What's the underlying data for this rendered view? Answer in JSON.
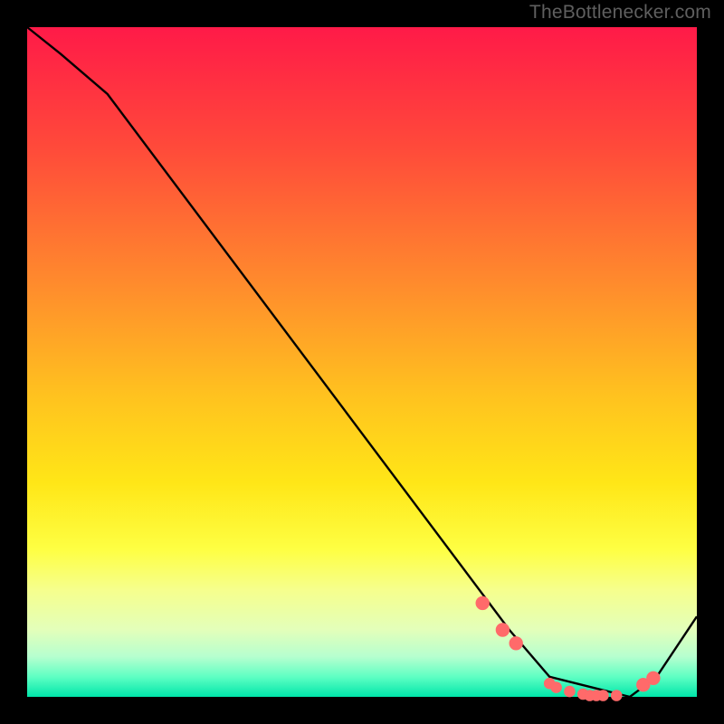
{
  "attribution": "TheBottlenecker.com",
  "colors": {
    "background": "#000000",
    "curve_stroke": "#000000",
    "marker_fill": "#ff6a6a",
    "marker_stroke": "#ff6a6a",
    "gradient_top": "#ff1a48",
    "gradient_bottom": "#00e6aa"
  },
  "chart_data": {
    "type": "line",
    "title": "",
    "xlabel": "",
    "ylabel": "",
    "xlim": [
      0,
      100
    ],
    "ylim": [
      0,
      100
    ],
    "x": [
      0,
      5,
      12,
      72,
      78,
      90,
      94,
      100
    ],
    "values": [
      100,
      96,
      90,
      10,
      3,
      0,
      3,
      12
    ],
    "markers": {
      "x": [
        68,
        71,
        73,
        78,
        79,
        81,
        83,
        84,
        85,
        86,
        88,
        92,
        93.5
      ],
      "y": [
        14,
        10,
        8,
        2,
        1.4,
        0.8,
        0.4,
        0.2,
        0.2,
        0.2,
        0.2,
        1.8,
        2.8
      ]
    }
  }
}
